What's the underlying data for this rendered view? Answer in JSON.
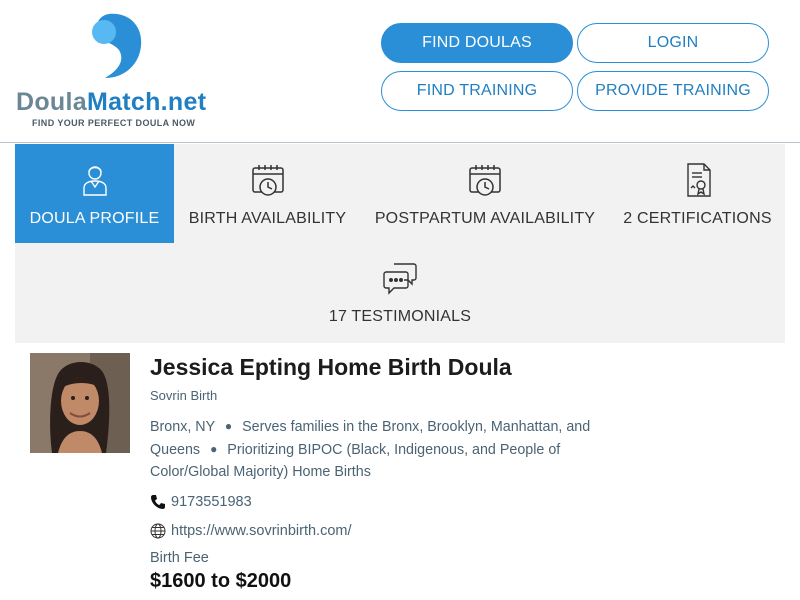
{
  "brand": {
    "name_part1": "Doula",
    "name_part2": "Match.net",
    "tagline": "FIND YOUR PERFECT DOULA NOW",
    "colors": {
      "primary": "#2a8fd6",
      "light": "#4fb3ef",
      "gray": "#6b8796"
    }
  },
  "nav": {
    "find_doulas": "FIND DOULAS",
    "login": "LOGIN",
    "find_training": "FIND TRAINING",
    "provide_training": "PROVIDE TRAINING"
  },
  "tabs": [
    {
      "label": "DOULA PROFILE",
      "icon": "person-icon",
      "active": true
    },
    {
      "label": "BIRTH AVAILABILITY",
      "icon": "calendar-clock-icon",
      "active": false
    },
    {
      "label": "POSTPARTUM AVAILABILITY",
      "icon": "calendar-clock-icon",
      "active": false
    },
    {
      "label": "2 CERTIFICATIONS",
      "icon": "certificate-icon",
      "active": false
    },
    {
      "label": "17 TESTIMONIALS",
      "icon": "chat-bubbles-icon",
      "active": false
    }
  ],
  "profile": {
    "name": "Jessica Epting Home Birth Doula",
    "organization": "Sovrin Birth",
    "location": "Bronx, NY",
    "service_area": "Serves families in the Bronx, Brooklyn, Manhattan, and Queens",
    "focus": "Prioritizing BIPOC (Black, Indigenous, and People of Color/Global Majority) Home Births",
    "phone": "9173551983",
    "website": "https://www.sovrinbirth.com/",
    "fee_label": "Birth Fee",
    "fee_value": "$1600 to $2000"
  }
}
